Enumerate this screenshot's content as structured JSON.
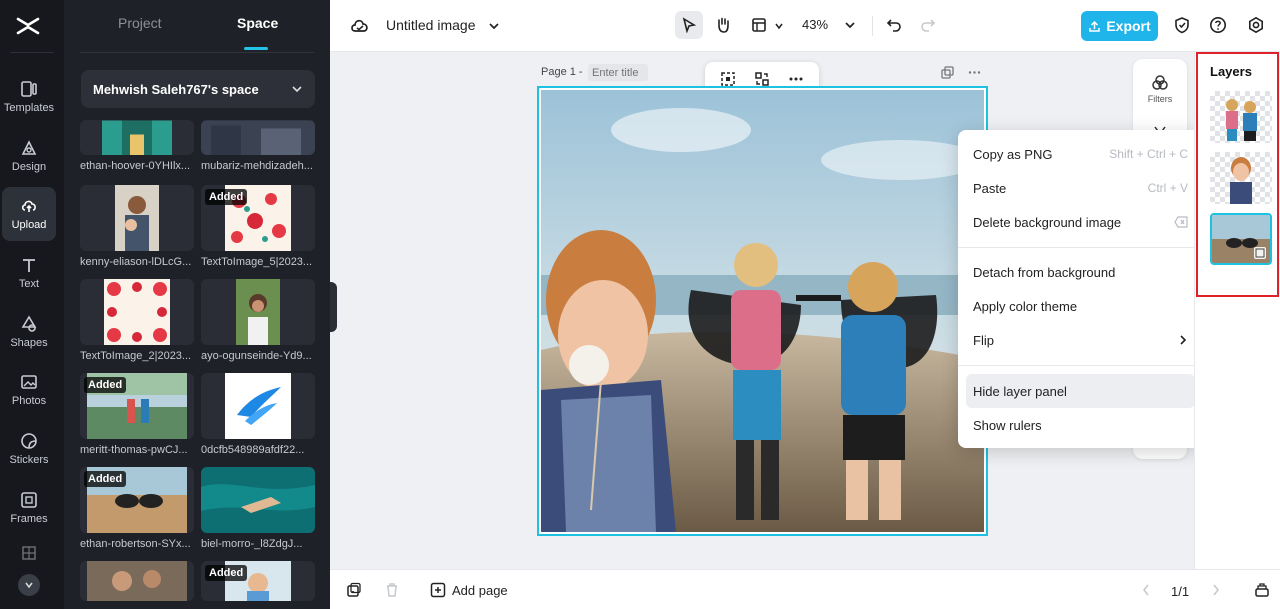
{
  "rail": {
    "items": [
      {
        "label": "Templates",
        "icon": "templates-icon"
      },
      {
        "label": "Design",
        "icon": "design-icon"
      },
      {
        "label": "Upload",
        "icon": "upload-icon"
      },
      {
        "label": "Text",
        "icon": "text-icon"
      },
      {
        "label": "Shapes",
        "icon": "shapes-icon"
      },
      {
        "label": "Photos",
        "icon": "photos-icon"
      },
      {
        "label": "Stickers",
        "icon": "stickers-icon"
      },
      {
        "label": "Frames",
        "icon": "frames-icon"
      }
    ]
  },
  "panel": {
    "tab_project": "Project",
    "tab_space": "Space",
    "space_name": "Mehwish Saleh767's space",
    "items": [
      {
        "label": "ethan-hoover-0YHIlx...",
        "badge": ""
      },
      {
        "label": "mubariz-mehdizadeh...",
        "badge": ""
      },
      {
        "label": "kenny-eliason-lDLcG...",
        "badge": ""
      },
      {
        "label": "TextToImage_5|2023...",
        "badge": "Added"
      },
      {
        "label": "TextToImage_2|2023...",
        "badge": ""
      },
      {
        "label": "ayo-ogunseinde-Yd9...",
        "badge": ""
      },
      {
        "label": "meritt-thomas-pwCJ...",
        "badge": "Added"
      },
      {
        "label": "0dcfb548989afdf22...",
        "badge": ""
      },
      {
        "label": "ethan-robertson-SYx...",
        "badge": "Added"
      },
      {
        "label": "biel-morro-_l8ZdgJ...",
        "badge": ""
      },
      {
        "label": "",
        "badge": ""
      },
      {
        "label": "",
        "badge": "Added"
      }
    ]
  },
  "topbar": {
    "doc_title": "Untitled image",
    "zoom": "43%",
    "export_label": "Export"
  },
  "canvas": {
    "page_label": "Page 1 -",
    "page_title_placeholder": "Enter title"
  },
  "toolstrip": {
    "filters_label": "Filters"
  },
  "context_menu": {
    "copy_png": "Copy as PNG",
    "copy_png_sc": "Shift + Ctrl + C",
    "paste": "Paste",
    "paste_sc": "Ctrl + V",
    "delete_bg": "Delete background image",
    "detach": "Detach from background",
    "apply_theme": "Apply color theme",
    "flip": "Flip",
    "hide_layer": "Hide layer panel",
    "show_rulers": "Show rulers"
  },
  "layers": {
    "title": "Layers"
  },
  "bottombar": {
    "add_page": "Add page",
    "pager": "1/1"
  },
  "colors": {
    "accent": "#1fb5ea",
    "selection": "#1ec2e0",
    "highlight_box": "#e0202a",
    "rail_bg": "#16181d",
    "panel_bg": "#1f2128"
  }
}
